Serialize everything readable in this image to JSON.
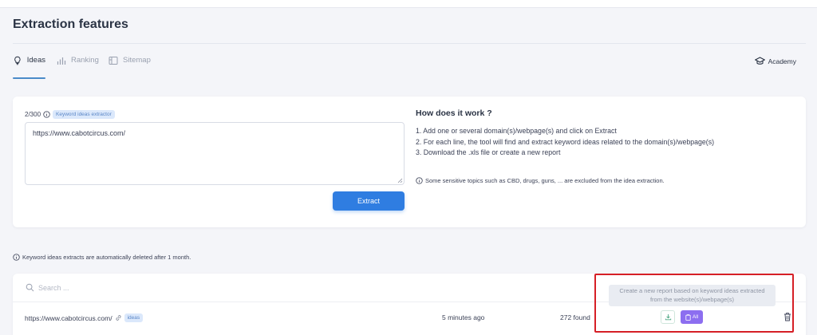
{
  "page": {
    "title": "Extraction features"
  },
  "tabs": [
    {
      "label": "Ideas",
      "icon": "lightbulb-icon",
      "active": true
    },
    {
      "label": "Ranking",
      "icon": "bar-chart-icon",
      "active": false
    },
    {
      "label": "Sitemap",
      "icon": "sitemap-icon",
      "active": false
    }
  ],
  "academy": {
    "label": "Academy",
    "icon": "graduation-cap-icon"
  },
  "extractor": {
    "counter": "2/300",
    "badge": "Keyword ideas extractor",
    "input_value": "https://www.cabotcircus.com/",
    "button_label": "Extract"
  },
  "how": {
    "title": "How does it work ?",
    "steps": [
      "1. Add one or several domain(s)/webpage(s) and click on Extract",
      "2. For each line, the tool will find and extract keyword ideas related to the domain(s)/webpage(s)",
      "3. Download the .xls file or create a new report"
    ],
    "note": "Some sensitive topics such as CBD, drugs, guns, ... are excluded from the idea extraction."
  },
  "delete_note": "Keyword ideas extracts are automatically deleted after 1 month.",
  "list": {
    "search_placeholder": "Search ...",
    "rows": [
      {
        "url": "https://www.cabotcircus.com/",
        "tag": "ideas",
        "time": "5 minutes ago",
        "found": "272 found",
        "all_label": "All"
      }
    ]
  },
  "tooltip": {
    "line1": "Create a new report based on keyword ideas extracted",
    "line2": "from the website(s)/webpage(s)"
  },
  "colors": {
    "accent": "#2f7de1",
    "all_button": "#8c6ef0",
    "highlight": "#d61f26",
    "tab_underline": "#4a8bc9"
  }
}
